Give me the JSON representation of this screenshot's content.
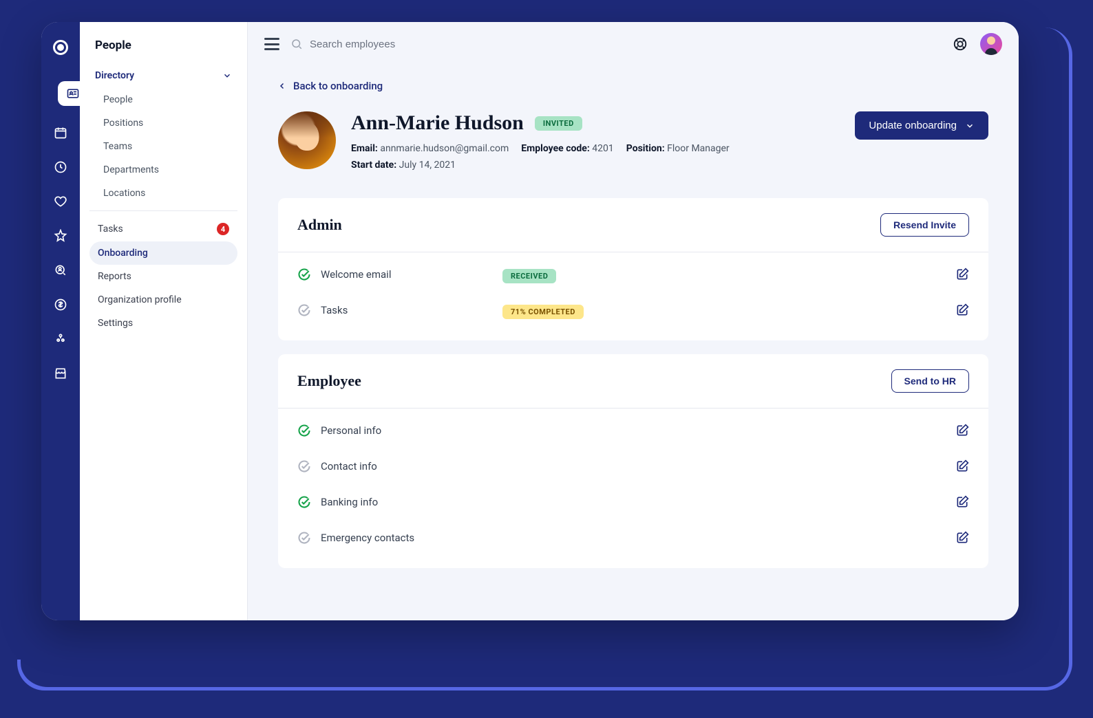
{
  "sidebar": {
    "title": "People",
    "directory": {
      "label": "Directory",
      "items": [
        "People",
        "Positions",
        "Teams",
        "Departments",
        "Locations"
      ]
    },
    "nav": {
      "tasks": "Tasks",
      "tasks_badge": "4",
      "onboarding": "Onboarding",
      "reports": "Reports",
      "org_profile": "Organization profile",
      "settings": "Settings"
    }
  },
  "topbar": {
    "search_placeholder": "Search employees"
  },
  "back_link": "Back to onboarding",
  "profile": {
    "name": "Ann-Marie Hudson",
    "status": "INVITED",
    "email_label": "Email:",
    "email": "annmarie.hudson@gmail.com",
    "emp_code_label": "Employee code:",
    "emp_code": "4201",
    "position_label": "Position:",
    "position": "Floor Manager",
    "start_label": "Start date:",
    "start_date": "July 14, 2021",
    "update_btn": "Update onboarding"
  },
  "admin_card": {
    "title": "Admin",
    "action": "Resend Invite",
    "welcome_label": "Welcome email",
    "welcome_status": "RECEIVED",
    "tasks_label": "Tasks",
    "tasks_status": "71% COMPLETED"
  },
  "employee_card": {
    "title": "Employee",
    "action": "Send to HR",
    "personal": "Personal info",
    "contact": "Contact info",
    "banking": "Banking info",
    "emergency": "Emergency contacts"
  }
}
